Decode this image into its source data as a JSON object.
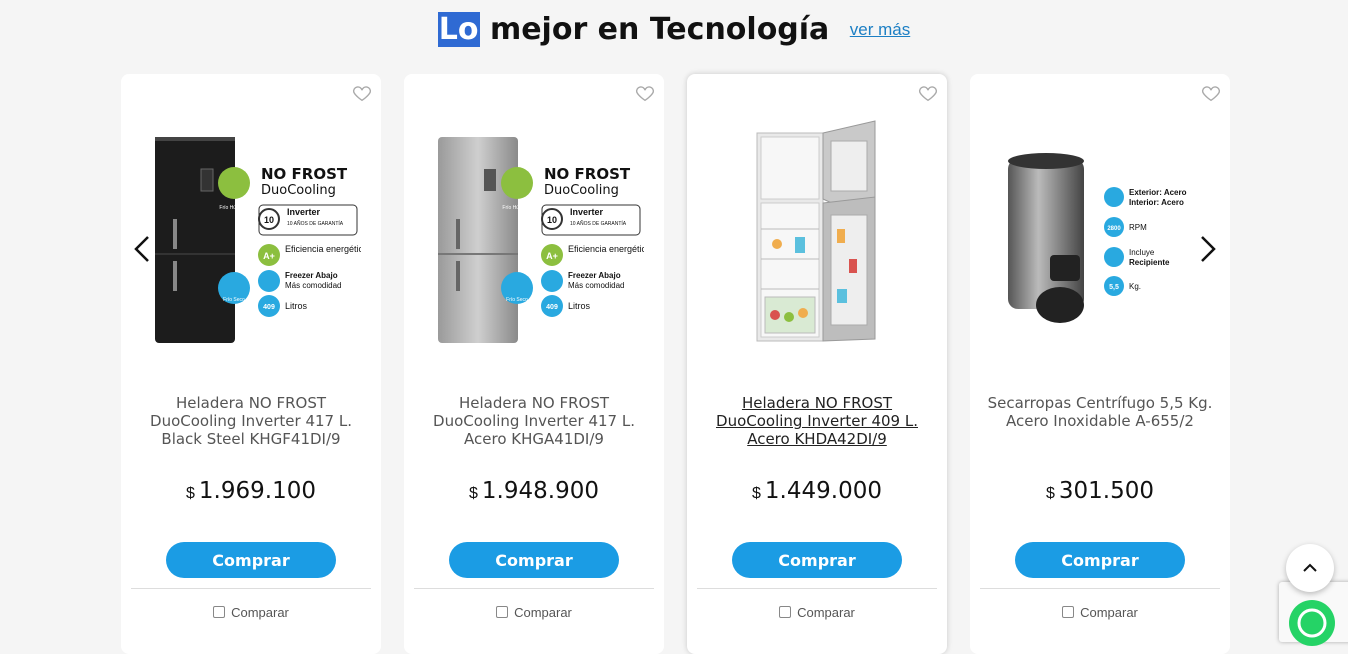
{
  "section": {
    "title_highlight": "Lo",
    "title_rest": " mejor en Tecnología",
    "more_link": "ver más"
  },
  "products": [
    {
      "name": "Heladera NO FROST DuoCooling Inverter 417 L. Black Steel KHGF41DI/9",
      "currency": "$",
      "price": "1.969.100",
      "buy": "Comprar",
      "compare": "Comparar",
      "badge_title": "NO FROST",
      "badge_sub": "DuoCooling",
      "feat_inverter": "Inverter",
      "feat_warranty": "10 AÑOS DE GARANTÍA",
      "feat_eff": "Eficiencia energética A+",
      "feat_freezer": "Freezer Abajo",
      "feat_freezer_sub": "Más comodidad",
      "feat_liters": "409",
      "feat_liters_label": "Litros",
      "bubble_top": "Frío Húmedo",
      "bubble_bottom": "Frío Seco",
      "aplus": "A+"
    },
    {
      "name": "Heladera NO FROST DuoCooling Inverter 417 L. Acero KHGA41DI/9",
      "currency": "$",
      "price": "1.948.900",
      "buy": "Comprar",
      "compare": "Comparar",
      "badge_title": "NO FROST",
      "badge_sub": "DuoCooling",
      "feat_inverter": "Inverter",
      "feat_warranty": "10 AÑOS DE GARANTÍA",
      "feat_eff": "Eficiencia energética A+",
      "feat_freezer": "Freezer Abajo",
      "feat_freezer_sub": "Más comodidad",
      "feat_liters": "409",
      "feat_liters_label": "Litros",
      "bubble_top": "Frío Húmedo",
      "bubble_bottom": "Frío Seco",
      "aplus": "A+"
    },
    {
      "name": "Heladera NO FROST DuoCooling Inverter 409 L. Acero KHDA42DI/9",
      "currency": "$",
      "price": "1.449.000",
      "buy": "Comprar",
      "compare": "Comparar"
    },
    {
      "name": "Secarropas Centrífugo 5,5 Kg. Acero Inoxidable A-655/2",
      "currency": "$",
      "price": "301.500",
      "buy": "Comprar",
      "compare": "Comparar",
      "f1a": "Exterior: Acero",
      "f1b": "Interior: Acero",
      "f2n": "2800",
      "f2": "RPM",
      "f3a": "Incluye",
      "f3b": "Recipiente",
      "f4n": "5,5",
      "f4": "Kg."
    }
  ],
  "colors": {
    "accent": "#1b9ce4",
    "highlight": "#2f6ad3",
    "link": "#1c7fc4"
  }
}
